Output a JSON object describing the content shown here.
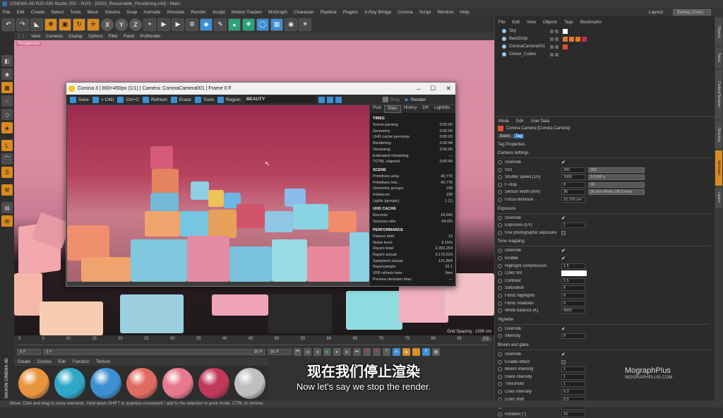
{
  "app": {
    "title": "CINEMA 4D R20.030 Studio (RC - R20) - [0503_Resumable_Rendering.c4d] - Main",
    "menu": [
      "File",
      "Edit",
      "Create",
      "Select",
      "Tools",
      "Mesh",
      "Volume",
      "Snap",
      "Animate",
      "Simulate",
      "Render",
      "Sculpt",
      "Motion Tracker",
      "MoGraph",
      "Character",
      "Pipeline",
      "Plugins",
      "V-Ray Bridge",
      "Corona",
      "Script",
      "Window",
      "Help"
    ],
    "layout_label": "Layout:",
    "layout_value": "Startup (User)"
  },
  "viewport": {
    "menu": [
      "View",
      "Cameras",
      "Display",
      "Options",
      "Filter",
      "Panel",
      "ProRender"
    ],
    "label": "Perspective",
    "grid_spacing": "Grid Spacing : 1000 cm"
  },
  "timeline": {
    "ticks": [
      "0",
      "5",
      "10",
      "15",
      "20",
      "25",
      "30",
      "35",
      "40",
      "45",
      "50",
      "55",
      "60",
      "65",
      "70",
      "75",
      "80",
      "85",
      "90"
    ],
    "current_frame": "0 F",
    "start": "0 F",
    "end": "90 F",
    "max": "90 F",
    "end_field": "0 F"
  },
  "materials": {
    "menu": [
      "Create",
      "Corona",
      "Edit",
      "Function",
      "Texture"
    ],
    "colors": [
      "#e8953d",
      "#2fa7c7",
      "#3c8fd1",
      "#e16a60",
      "#e7788e",
      "#c0385a",
      "#bfbfbf"
    ]
  },
  "statusbar": "Move: Click and drag to move elements. Hold down SHIFT to quantize movement / add to the selection in point mode, CTRL to remove.",
  "objects": {
    "menu": [
      "File",
      "Edit",
      "View",
      "Objects",
      "Tags",
      "Bookmarks"
    ],
    "items": [
      {
        "name": "Sky",
        "tags": [
          "#ffffff"
        ]
      },
      {
        "name": "BackDrop",
        "tags": [
          "#e07a2a",
          "#e07a2a",
          "#e07a2a",
          "#c03050"
        ]
      },
      {
        "name": "CoronaCamera001",
        "tags": [
          "#e0502a"
        ]
      },
      {
        "name": "Cloner_Cubes",
        "tags": []
      }
    ]
  },
  "side_tabs": [
    "Objects",
    "Takes",
    "Content Browser",
    "Structure",
    "Attributes",
    "Layers"
  ],
  "attributes": {
    "menu": [
      "Mode",
      "Edit",
      "User Data"
    ],
    "title": "Corona Camera [Corona Camera]",
    "tabs": [
      "Basic",
      "Tag"
    ],
    "subheading": "Tag Properties",
    "sections": {
      "camera": "Camera settings",
      "exposure": "Exposure",
      "tonemap": "Tone mapping",
      "vignette": "Vignette",
      "bloom": "Bloom and glare"
    },
    "camera_rows": [
      {
        "label": "Override",
        "check": "✔"
      },
      {
        "label": "ISO",
        "value": "200",
        "select": "200"
      },
      {
        "label": "Shutter speed [1/s]",
        "value": "1000",
        "select": "1/1000 s"
      },
      {
        "label": "F-stop",
        "value": "8",
        "select": "f/8"
      },
      {
        "label": "Sensor width (mm)",
        "value": "36",
        "select": "35 mm Photo (36.0 mm)"
      },
      {
        "label": "Focus distance",
        "value": "15.705 cm"
      }
    ],
    "exposure_rows": [
      {
        "label": "Override",
        "check": "✔"
      },
      {
        "label": "Exposure (EV)",
        "value": "1"
      },
      {
        "label": "Use photographic exposure",
        "check": ""
      }
    ],
    "tonemap_rows": [
      {
        "label": "Override",
        "check": "✔"
      },
      {
        "label": "Enable",
        "check": "✔"
      },
      {
        "label": "Highlight compression",
        "value": "1.5"
      },
      {
        "label": "Color tint",
        "value": ""
      },
      {
        "label": "Contrast",
        "value": "1.5"
      },
      {
        "label": "Saturation",
        "value": "0"
      },
      {
        "label": "Filmic highlights",
        "value": "0"
      },
      {
        "label": "Filmic shadows",
        "value": "0"
      },
      {
        "label": "White balance [K]",
        "value": "6500"
      }
    ],
    "vignette_rows": [
      {
        "label": "Override",
        "check": "✔"
      },
      {
        "label": "Intensity",
        "value": "0"
      }
    ],
    "bloom_rows": [
      {
        "label": "Override",
        "check": "✔"
      },
      {
        "label": "Enable effect",
        "check": ""
      },
      {
        "label": "Bloom intensity",
        "value": "1"
      },
      {
        "label": "Glare intensity",
        "value": "1"
      },
      {
        "label": "Threshold",
        "value": "1"
      },
      {
        "label": "Color intensity",
        "value": "0.3"
      },
      {
        "label": "Color shift",
        "value": "0.5"
      },
      {
        "label": "Streak count",
        "value": "3"
      },
      {
        "label": "Rotation [°]",
        "value": "15"
      }
    ]
  },
  "corona": {
    "title": "Corona 3 | 800×450px (1/1) | Camera: CoronaCamera001 | Frame 0 F",
    "toolbar": [
      "Save",
      "> C4D",
      "Ctrl+C",
      "Refresh",
      "Erase",
      "Tools",
      "Region"
    ],
    "pass": "BEAUTY",
    "stop": "Stop",
    "render": "Render",
    "tabs": [
      "Post",
      "Stats",
      "History",
      "DR",
      "LightMix"
    ],
    "stats": [
      {
        "head": "TIMES",
        "rows": [
          [
            "Scene parsing:",
            "0:00:00"
          ],
          [
            "Geometry:",
            "0:00:00"
          ],
          [
            "UHD cache precomp:",
            "0:00:03"
          ],
          [
            "Rendering:",
            "0:00:44"
          ],
          [
            "Denoising:",
            "0:00:00"
          ],
          [
            "Estimated remaining:",
            "---"
          ],
          [
            "TOTAL elapsed:",
            "0:00:49"
          ]
        ]
      },
      {
        "head": "SCENE",
        "rows": [
          [
            "Primitives uniq.:",
            "40,776"
          ],
          [
            "Primitives inst.:",
            "40,776"
          ],
          [
            "Geometry groups:",
            "199"
          ],
          [
            "Instances:",
            "199"
          ],
          [
            "Lights (groups):",
            "1 (1)"
          ]
        ]
      },
      {
        "head": "UHD CACHE",
        "rows": [
          [
            "Records:",
            "24,943"
          ],
          [
            "Success rate:",
            "64.5%"
          ]
        ]
      },
      {
        "head": "PERFORMANCE",
        "rows": [
          [
            "Passes total:",
            "13"
          ],
          [
            "Noise level:",
            "6.15%"
          ],
          [
            "Rays/s total:",
            "2,393,204"
          ],
          [
            "Rays/s actual:",
            "2,176,533"
          ],
          [
            "Samples/s actual:",
            "121,804"
          ],
          [
            "Rays/sample:",
            "22.1"
          ],
          [
            "VFB refresh time:",
            "9ms"
          ],
          [
            "Preview denoiser time:",
            "---"
          ]
        ]
      }
    ]
  },
  "subtitles": {
    "zh": "现在我们停止渲染",
    "en": "Now let's say we stop the render."
  },
  "brand": {
    "line1": "MographPlus",
    "line2": "MOGRAPHPLUS.COM"
  },
  "maxon_label": "MAXON CINEMA 4D"
}
